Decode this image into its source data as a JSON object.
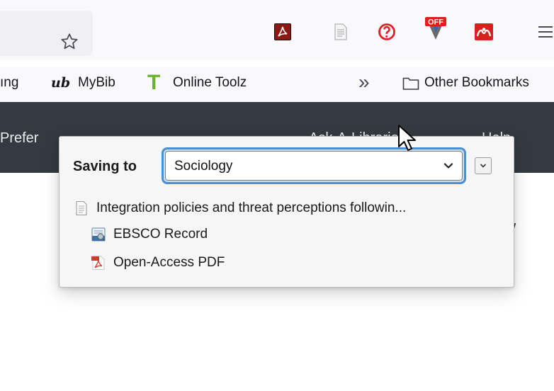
{
  "toolbar": {
    "icons": [
      "bookmark-star-icon",
      "adobe-acrobat-icon",
      "reader-view-icon",
      "red-circle-extension-icon",
      "off-badge-extension-icon",
      "mendeley-extension-icon",
      "hamburger-menu-icon"
    ],
    "off_badge": "OFF"
  },
  "bookmarks": {
    "item1_label": "ıng",
    "mybib_logo": "ub",
    "mybib_label": "MyBib",
    "onlinetoolz_logo": "T",
    "onlinetoolz_label": "Online Toolz",
    "overflow": "»",
    "other_label": "Other Bookmarks"
  },
  "page": {
    "nav_left": "Prefer",
    "nav_mid": "Ask-A-Librarian",
    "nav_right": "Help",
    "right_glyph": "/"
  },
  "popup": {
    "saving_label": "Saving to",
    "collection": "Sociology",
    "item_title": "Integration policies and threat perceptions followin...",
    "attachments": [
      {
        "label": "EBSCO Record",
        "icon": "ebsco-record-icon"
      },
      {
        "label": "Open-Access PDF",
        "icon": "pdf-icon"
      }
    ]
  },
  "colors": {
    "focus_ring": "#4a90d9",
    "dark_nav": "#343a40",
    "pdf_red": "#d3392b"
  }
}
